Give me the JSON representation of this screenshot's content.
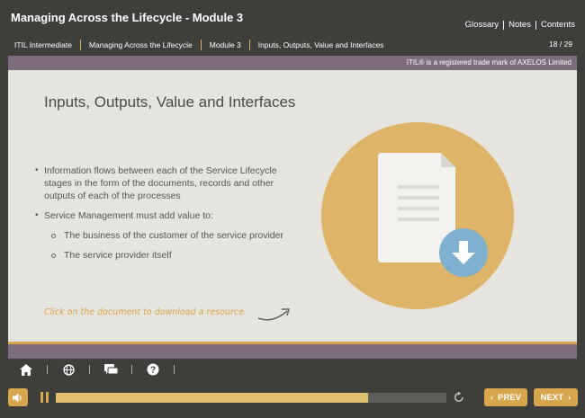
{
  "header": {
    "title": "Managing Across the Lifecycle - Module 3",
    "links": [
      "Glossary",
      "Notes",
      "Contents"
    ]
  },
  "breadcrumb": {
    "items": [
      "ITIL Intermediate",
      "Managing Across the Lifecycle",
      "Module 3",
      "Inputs, Outputs, Value and Interfaces"
    ],
    "page": "18 / 29"
  },
  "trademark": "ITIL® is a registered trade mark of AXELOS Limited",
  "slide": {
    "title": "Inputs, Outputs, Value and Interfaces",
    "bullet1": "Information flows between each of the Service Lifecycle stages in the form of the documents, records and other outputs of each of the processes",
    "bullet2": "Service Management must add value to:",
    "sub1": "The business of the customer of the service provider",
    "sub2": "The service provider itself",
    "hint": "Click on the document to download a resource."
  },
  "toolbar_icons": [
    "home-icon",
    "globe-icon",
    "chat-icon",
    "help-icon"
  ],
  "controls": {
    "progress": 0.8,
    "prev_label": "PREV",
    "next_label": "NEXT"
  },
  "colors": {
    "accent": "#d8a64c",
    "purple_bar": "#7c6c7e",
    "background": "#3e3e3b",
    "slide": "#e6e4de",
    "download": "#7fb0cf"
  }
}
